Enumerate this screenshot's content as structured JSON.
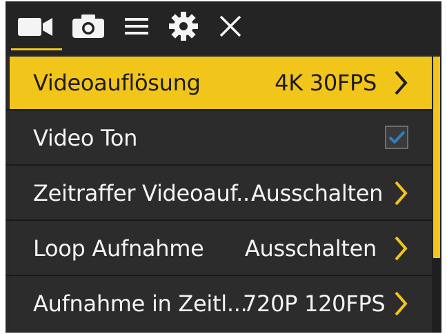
{
  "tabs": [
    {
      "icon": "video-camera-icon",
      "active": true
    },
    {
      "icon": "photo-camera-icon",
      "active": false
    },
    {
      "icon": "menu-icon",
      "active": false
    },
    {
      "icon": "gear-icon",
      "active": false
    },
    {
      "icon": "close-icon",
      "active": false
    }
  ],
  "menu": {
    "items": [
      {
        "label": "Videoauflösung",
        "value": "4K 30FPS",
        "control": "chevron",
        "selected": true
      },
      {
        "label": "Video Ton",
        "value": "",
        "control": "checkbox",
        "checked": true,
        "selected": false
      },
      {
        "label": "Zeitraffer Videoauf...",
        "value": "Ausschalten",
        "control": "chevron",
        "selected": false
      },
      {
        "label": "Loop Aufnahme",
        "value": "Ausschalten",
        "control": "chevron",
        "selected": false
      },
      {
        "label": "Aufnahme in Zeitl...",
        "value": "720P 120FPS",
        "control": "chevron",
        "selected": false
      }
    ]
  },
  "colors": {
    "accent": "#f2c51a",
    "background": "#2a2a2a",
    "checkmark": "#2f7fc4"
  },
  "scroll": {
    "position_fraction": 0.0,
    "visible_fraction": 0.73
  }
}
